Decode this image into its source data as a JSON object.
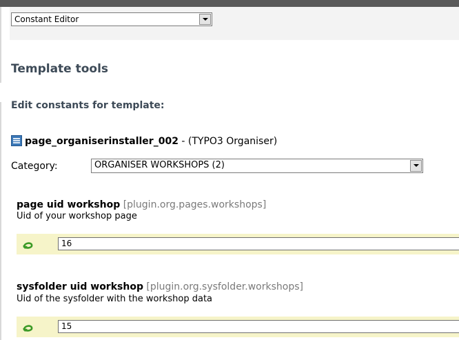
{
  "module_menu": {
    "selected": "Constant Editor"
  },
  "page": {
    "title": "Template tools",
    "section_heading": "Edit constants for template:"
  },
  "template": {
    "icon": "template-icon",
    "name": "page_organiserinstaller_002",
    "suffix": " - (TYPO3 Organiser)"
  },
  "category": {
    "label": "Category:",
    "selected": "ORGANISER WORKSHOPS (2)"
  },
  "constants": [
    {
      "title": "page uid workshop",
      "key": "[plugin.org.pages.workshops]",
      "description": "Uid of your workshop page",
      "value": "16",
      "icon": "revert-icon"
    },
    {
      "title": "sysfolder uid workshop",
      "key": "[plugin.org.sysfolder.workshops]",
      "description": "Uid of the sysfolder with the workshop data",
      "value": "15",
      "icon": "revert-icon"
    }
  ],
  "colors": {
    "heading": "#3d4a57",
    "input_band": "#f6f4c9",
    "revert_icon": "#3b9a26"
  }
}
